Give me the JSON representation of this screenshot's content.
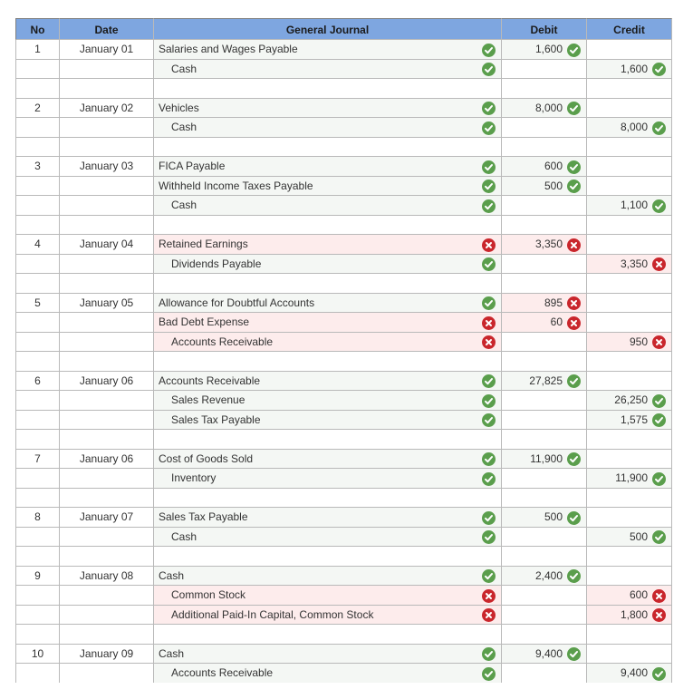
{
  "columns": {
    "no": "No",
    "date": "Date",
    "account": "General Journal",
    "debit": "Debit",
    "credit": "Credit"
  },
  "entries": [
    {
      "no": "1",
      "date": "January 01",
      "lines": [
        {
          "account": "Salaries and Wages Payable",
          "indent": false,
          "status": "correct",
          "debit": "1,600",
          "debit_status": "correct",
          "credit": "",
          "credit_status": ""
        },
        {
          "account": "Cash",
          "indent": true,
          "status": "correct",
          "debit": "",
          "debit_status": "",
          "credit": "1,600",
          "credit_status": "correct"
        }
      ]
    },
    {
      "no": "2",
      "date": "January 02",
      "lines": [
        {
          "account": "Vehicles",
          "indent": false,
          "status": "correct",
          "debit": "8,000",
          "debit_status": "correct",
          "credit": "",
          "credit_status": ""
        },
        {
          "account": "Cash",
          "indent": true,
          "status": "correct",
          "debit": "",
          "debit_status": "",
          "credit": "8,000",
          "credit_status": "correct"
        }
      ]
    },
    {
      "no": "3",
      "date": "January 03",
      "lines": [
        {
          "account": "FICA Payable",
          "indent": false,
          "status": "correct",
          "debit": "600",
          "debit_status": "correct",
          "credit": "",
          "credit_status": ""
        },
        {
          "account": "Withheld Income Taxes Payable",
          "indent": false,
          "status": "correct",
          "debit": "500",
          "debit_status": "correct",
          "credit": "",
          "credit_status": ""
        },
        {
          "account": "Cash",
          "indent": true,
          "status": "correct",
          "debit": "",
          "debit_status": "",
          "credit": "1,100",
          "credit_status": "correct"
        }
      ]
    },
    {
      "no": "4",
      "date": "January 04",
      "lines": [
        {
          "account": "Retained Earnings",
          "indent": false,
          "status": "incorrect",
          "debit": "3,350",
          "debit_status": "incorrect",
          "credit": "",
          "credit_status": ""
        },
        {
          "account": "Dividends Payable",
          "indent": true,
          "status": "correct",
          "debit": "",
          "debit_status": "",
          "credit": "3,350",
          "credit_status": "incorrect"
        }
      ]
    },
    {
      "no": "5",
      "date": "January 05",
      "lines": [
        {
          "account": "Allowance for Doubtful Accounts",
          "indent": false,
          "status": "correct",
          "debit": "895",
          "debit_status": "incorrect",
          "credit": "",
          "credit_status": ""
        },
        {
          "account": "Bad Debt Expense",
          "indent": false,
          "status": "incorrect",
          "debit": "60",
          "debit_status": "incorrect",
          "credit": "",
          "credit_status": ""
        },
        {
          "account": "Accounts Receivable",
          "indent": true,
          "status": "incorrect",
          "debit": "",
          "debit_status": "",
          "credit": "950",
          "credit_status": "incorrect"
        }
      ]
    },
    {
      "no": "6",
      "date": "January 06",
      "lines": [
        {
          "account": "Accounts Receivable",
          "indent": false,
          "status": "correct",
          "debit": "27,825",
          "debit_status": "correct",
          "credit": "",
          "credit_status": ""
        },
        {
          "account": "Sales Revenue",
          "indent": true,
          "status": "correct",
          "debit": "",
          "debit_status": "",
          "credit": "26,250",
          "credit_status": "correct"
        },
        {
          "account": "Sales Tax Payable",
          "indent": true,
          "status": "correct",
          "debit": "",
          "debit_status": "",
          "credit": "1,575",
          "credit_status": "correct"
        }
      ]
    },
    {
      "no": "7",
      "date": "January 06",
      "lines": [
        {
          "account": "Cost of Goods Sold",
          "indent": false,
          "status": "correct",
          "debit": "11,900",
          "debit_status": "correct",
          "credit": "",
          "credit_status": ""
        },
        {
          "account": "Inventory",
          "indent": true,
          "status": "correct",
          "debit": "",
          "debit_status": "",
          "credit": "11,900",
          "credit_status": "correct"
        }
      ]
    },
    {
      "no": "8",
      "date": "January 07",
      "lines": [
        {
          "account": "Sales Tax Payable",
          "indent": false,
          "status": "correct",
          "debit": "500",
          "debit_status": "correct",
          "credit": "",
          "credit_status": ""
        },
        {
          "account": "Cash",
          "indent": true,
          "status": "correct",
          "debit": "",
          "debit_status": "",
          "credit": "500",
          "credit_status": "correct"
        }
      ]
    },
    {
      "no": "9",
      "date": "January 08",
      "lines": [
        {
          "account": "Cash",
          "indent": false,
          "status": "correct",
          "debit": "2,400",
          "debit_status": "correct",
          "credit": "",
          "credit_status": ""
        },
        {
          "account": "Common Stock",
          "indent": true,
          "status": "incorrect",
          "debit": "",
          "debit_status": "",
          "credit": "600",
          "credit_status": "incorrect"
        },
        {
          "account": "Additional Paid-In Capital, Common Stock",
          "indent": true,
          "status": "incorrect",
          "debit": "",
          "debit_status": "",
          "credit": "1,800",
          "credit_status": "incorrect"
        }
      ]
    },
    {
      "no": "10",
      "date": "January 09",
      "lines": [
        {
          "account": "Cash",
          "indent": false,
          "status": "correct",
          "debit": "9,400",
          "debit_status": "correct",
          "credit": "",
          "credit_status": ""
        },
        {
          "account": "Accounts Receivable",
          "indent": true,
          "status": "correct",
          "debit": "",
          "debit_status": "",
          "credit": "9,400",
          "credit_status": "correct"
        }
      ]
    }
  ],
  "colors": {
    "header": "#7ea6e0",
    "correct": "#5a9e4c",
    "incorrect": "#c9262c",
    "error_fill": "#fdecec"
  }
}
